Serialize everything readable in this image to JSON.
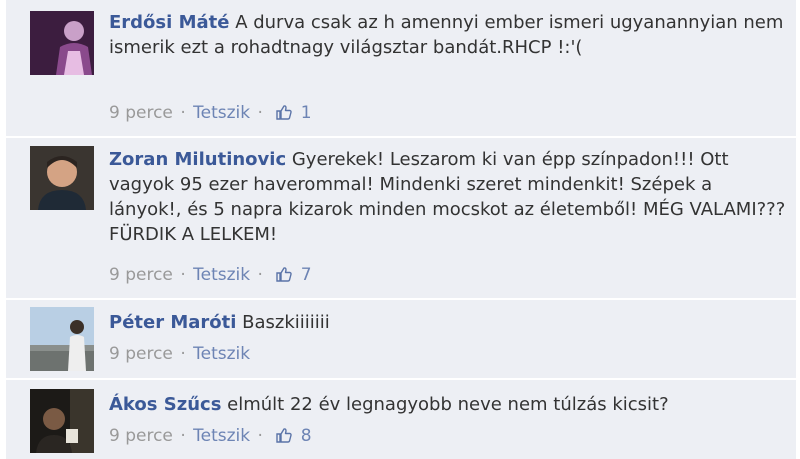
{
  "comments": [
    {
      "author": "Erdősi Máté",
      "text": "A durva csak az h amennyi ember ismeri ugyanannyian nem ismerik ezt a rohadtnagy világsztar bandát.RHCP !:'(",
      "time": "9 perce",
      "like_label": "Tetszik",
      "likes": "1",
      "avatar_icon": "avatar-person-icon"
    },
    {
      "author": "Zoran Milutinovic",
      "text": "Gyerekek! Leszarom ki van épp színpadon!!! Ott vagyok 95 ezer haverommal! Mindenki szeret mindenkit! Szépek a lányok!, és 5 napra kizarok minden mocskot az életemből! MÉG VALAMI??? FÜRDIK A LELKEM!",
      "time": "9 perce",
      "like_label": "Tetszik",
      "likes": "7",
      "avatar_icon": "avatar-person-icon"
    },
    {
      "author": "Péter Maróti",
      "text": "Baszkiiiiiii",
      "time": "9 perce",
      "like_label": "Tetszik",
      "likes": null,
      "avatar_icon": "avatar-person-icon"
    },
    {
      "author": "Ákos Szűcs",
      "text": "elmúlt 22 év legnagyobb neve nem túlzás kicsit?",
      "time": "9 perce",
      "like_label": "Tetszik",
      "likes": "8",
      "avatar_icon": "avatar-person-icon"
    }
  ],
  "colors": {
    "background": "#edeff4",
    "author": "#3b5998",
    "meta": "#999999",
    "like": "#6d84b4"
  }
}
